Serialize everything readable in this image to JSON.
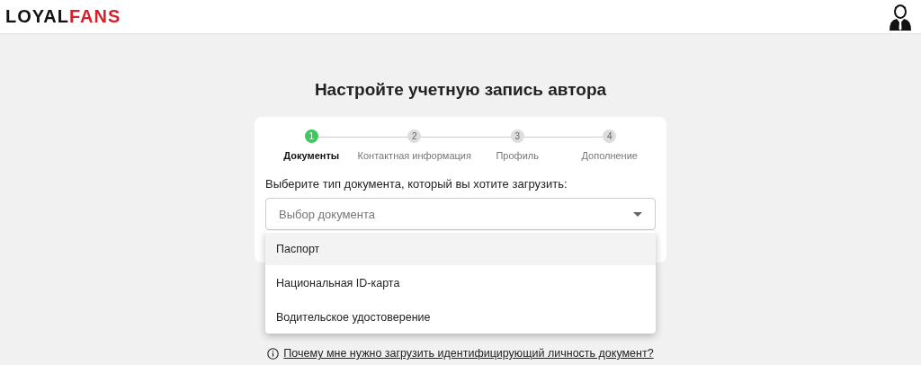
{
  "header": {
    "logo": {
      "main": "LOYAL",
      "accent": "FANS"
    }
  },
  "title": "Настройте учетную запись автора",
  "steps": [
    {
      "number": "1",
      "label": "Документы",
      "selected": true
    },
    {
      "number": "2",
      "label": "Контактная информация",
      "selected": false
    },
    {
      "number": "3",
      "label": "Профиль",
      "selected": false
    },
    {
      "number": "4",
      "label": "Дополнение",
      "selected": false
    }
  ],
  "prompt": "Выберите тип документа, который вы хотите загрузить:",
  "select": {
    "placeholder": "Выбор документа",
    "expanded": true
  },
  "options": [
    {
      "label": "Паспорт",
      "selected": true
    },
    {
      "label": "Национальная ID-карта",
      "selected": false
    },
    {
      "label": "Водительское удостоверение",
      "selected": false
    }
  ],
  "help_link": "Почему мне нужно загрузить идентифицирующий личность документ?"
}
